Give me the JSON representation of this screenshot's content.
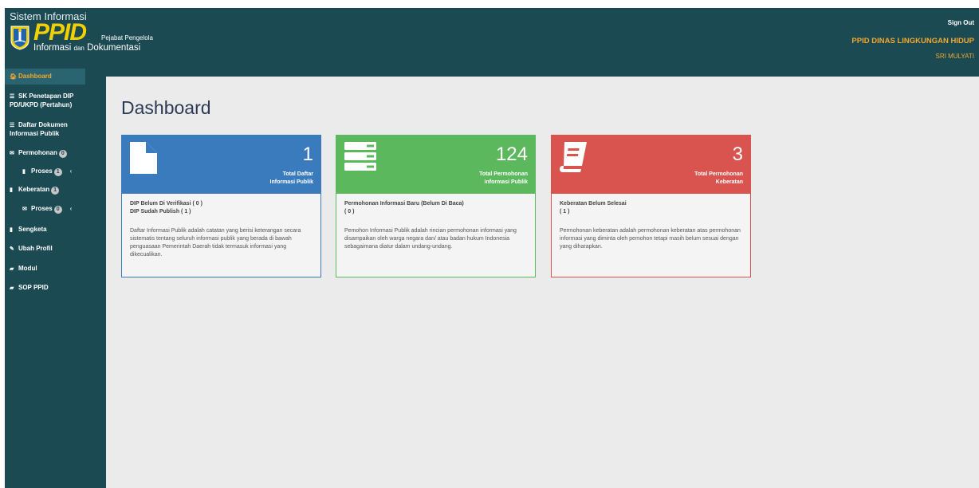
{
  "header": {
    "system_label": "Sistem Informasi",
    "brand": "PPID",
    "pejabat": "Pejabat Pengelola",
    "info_word": "Informasi",
    "dan_word": "dan",
    "dok_word": "Dokumentasi",
    "sign_out": "Sign Out",
    "org_name": "PPID DINAS LINGKUNGAN HIDUP",
    "user_name": "SRI MULYATI"
  },
  "sidebar": {
    "items": [
      {
        "label": "Dashboard",
        "icon": "home-icon"
      },
      {
        "label": "SK Penetapan DIP",
        "label2": "PD/UKPD (Pertahun)",
        "icon": "list-icon"
      },
      {
        "label": "Daftar Dokumen",
        "label2": "Informasi Publik",
        "icon": "list-icon"
      },
      {
        "label": "Permohonan",
        "badge": "0",
        "icon": "envelope-icon"
      },
      {
        "label": "Proses",
        "badge": "1",
        "icon": "file-icon"
      },
      {
        "label": "Keberatan",
        "badge": "1",
        "icon": "file-icon"
      },
      {
        "label": "Proses",
        "badge": "0",
        "icon": "envelope-icon"
      },
      {
        "label": "Sengketa",
        "icon": "file-icon"
      },
      {
        "label": "Ubah Profil",
        "icon": "edit-icon"
      },
      {
        "label": "Modul",
        "icon": "book-icon"
      },
      {
        "label": "SOP PPID",
        "icon": "book-icon"
      }
    ],
    "chevron": "‹"
  },
  "main": {
    "title": "Dashboard",
    "cards": [
      {
        "number": "1",
        "label1": "Total Daftar",
        "label2": "Informasi Publik",
        "stat1": "DIP Belum Di Verifikasi ( 0 )",
        "stat2": "DIP Sudah Publish ( 1 )",
        "desc": "Daftar Informasi Publik adalah catatan yang berisi keterangan secara sistematis tentang seluruh informasi publik yang berada di bawah penguasaan Pemerintah Daerah tidak termasuk informasi yang dikecualikan.",
        "color": "#3a7bbd",
        "icon": "document-icon"
      },
      {
        "number": "124",
        "label1": "Total Permohonan",
        "label2": "Informasi Publik",
        "stat1": "Permohonan Informasi Baru (Belum Di Baca)",
        "stat2": "( 0 )",
        "desc": "Pemohon Informasi Publik adalah rincian permohonan informasi yang disampaikan oleh warga negara dan/ atau badan hukum Indonesia sebagaimana diatur dalam undang-undang.",
        "color": "#5cb85c",
        "icon": "server-icon"
      },
      {
        "number": "3",
        "label1": "Total Permohonan",
        "label2": "Keberatan",
        "stat1": "Keberatan Belum Selesai",
        "stat2": "( 1 )",
        "desc": "Permohonan keberatan adalah permohonan keberatan atas permohonan informasi yang diminta oleh pemohon tetapi masih belum sesuai dengan yang diharapkan.",
        "color": "#d9534f",
        "icon": "book-icon"
      }
    ]
  }
}
